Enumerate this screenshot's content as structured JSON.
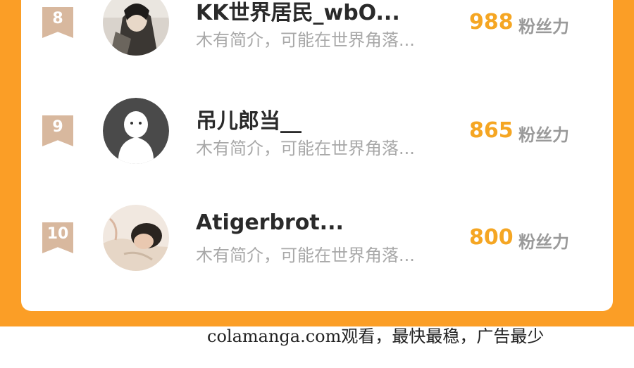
{
  "list": [
    {
      "rank": "8",
      "name": "KK世界居民_wbO...",
      "bio": "木有简介，可能在世界角落...",
      "score": "988",
      "unit": "粉丝力"
    },
    {
      "rank": "9",
      "name": "吊儿郎当__",
      "bio": "木有简介，可能在世界角落...",
      "score": "865",
      "unit": "粉丝力"
    },
    {
      "rank": "10",
      "name": "Atigerbrot...",
      "bio": "木有简介，可能在世界角落...",
      "score": "800",
      "unit": "粉丝力"
    }
  ],
  "footer": {
    "text": "colamanga.com观看，最快最稳，广告最少"
  },
  "colors": {
    "accent": "#fb9e26",
    "score": "#f5a623",
    "rank_badge": "#d8b89e"
  }
}
